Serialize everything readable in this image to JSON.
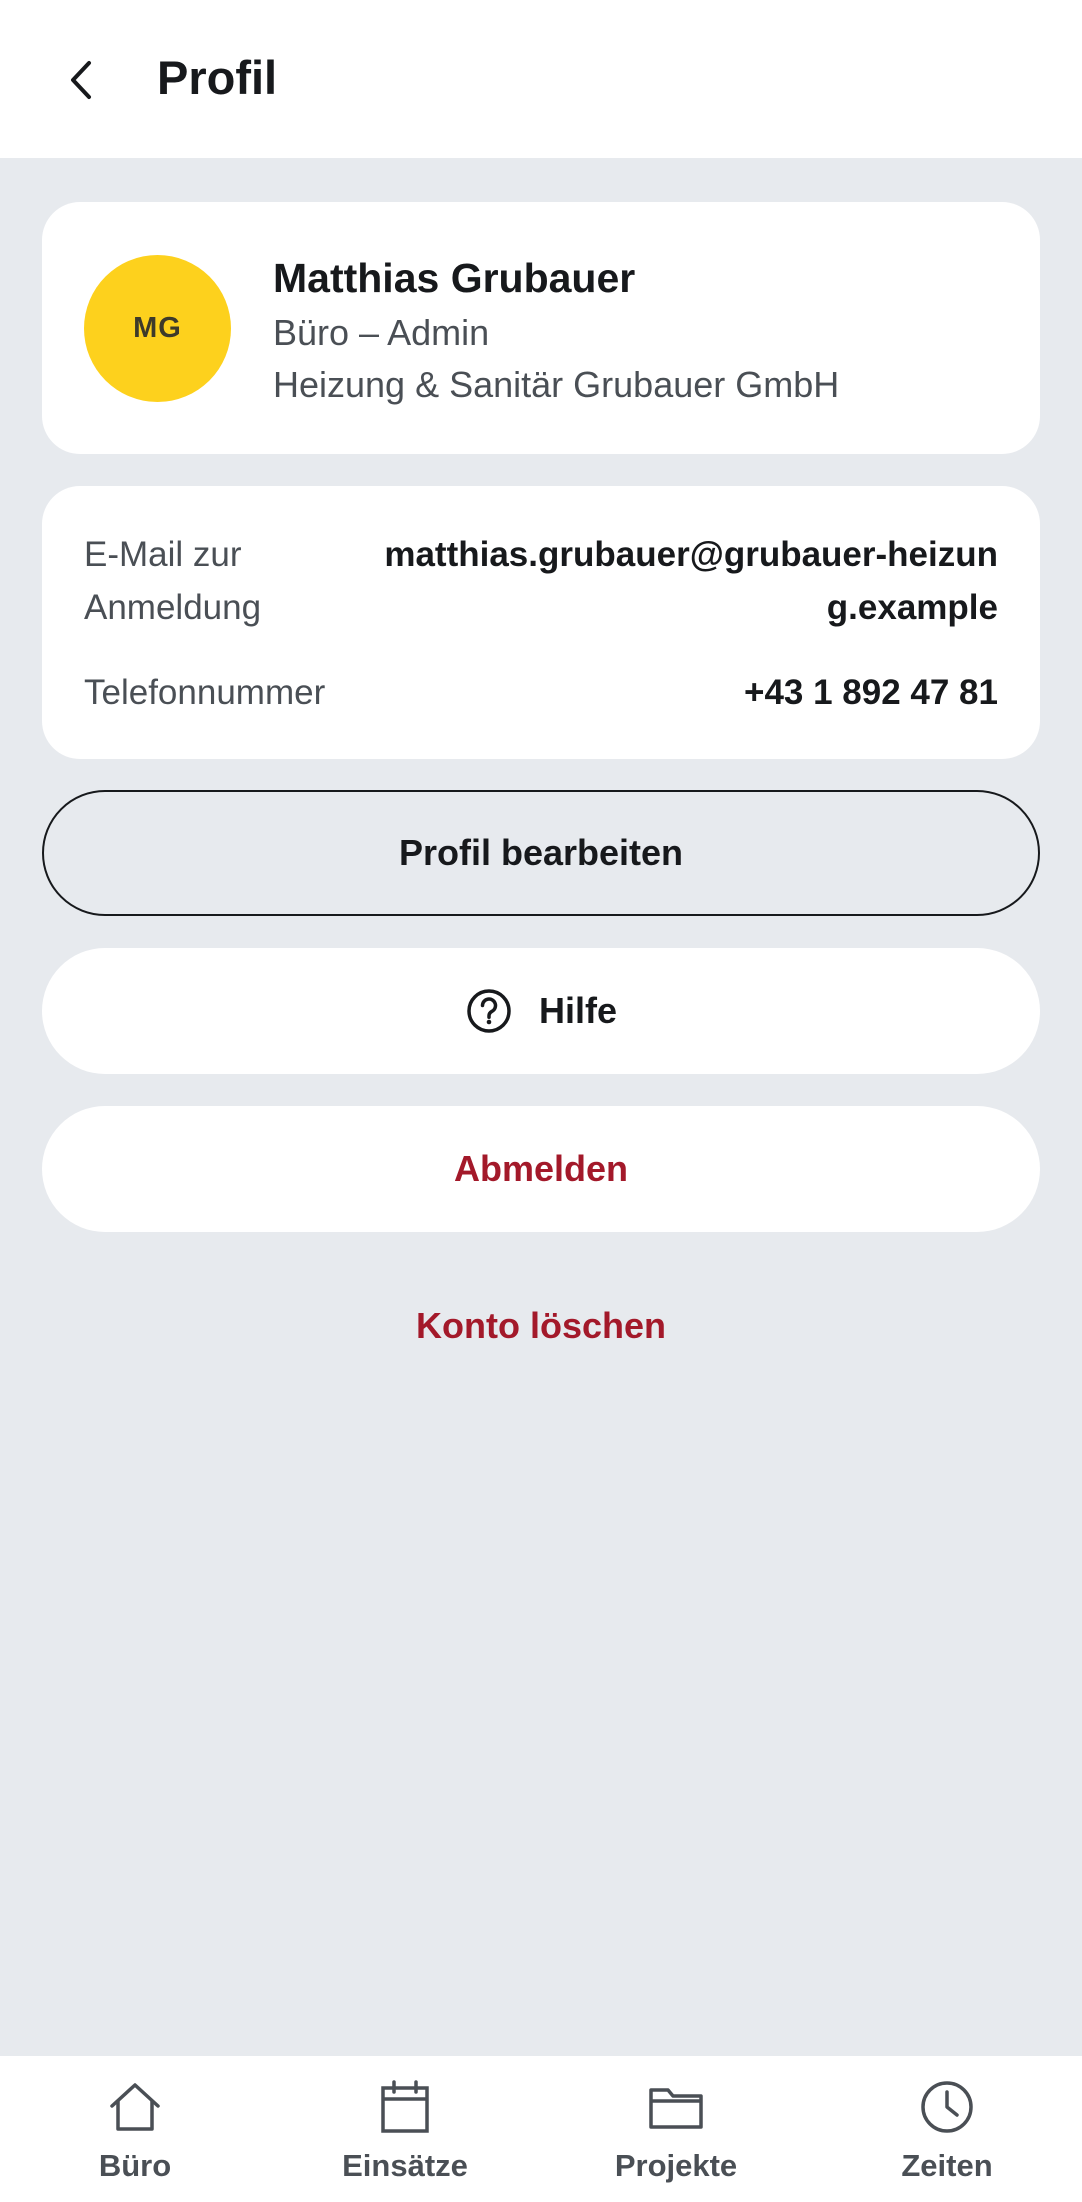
{
  "header": {
    "title": "Profil",
    "back_icon": "chevron-left-icon"
  },
  "profile": {
    "initials": "MG",
    "avatar_color": "#fdd11d",
    "name": "Matthias Grubauer",
    "role": "Büro – Admin",
    "company": "Heizung & Sanitär Grubauer GmbH"
  },
  "info": {
    "email_label": "E-Mail zur Anmeldung",
    "email_value": "matthias.grubauer@grubauer-heizung.example",
    "phone_label": "Telefonnummer",
    "phone_value": "+43 1 892 47 81"
  },
  "actions": {
    "edit_label": "Profil bearbeiten",
    "help_label": "Hilfe",
    "logout_label": "Abmelden",
    "delete_label": "Konto löschen",
    "danger_color": "#a3192a"
  },
  "nav": {
    "items": [
      {
        "label": "Büro",
        "icon": "home-icon"
      },
      {
        "label": "Einsätze",
        "icon": "calendar-icon"
      },
      {
        "label": "Projekte",
        "icon": "folder-icon"
      },
      {
        "label": "Zeiten",
        "icon": "clock-icon"
      }
    ]
  }
}
